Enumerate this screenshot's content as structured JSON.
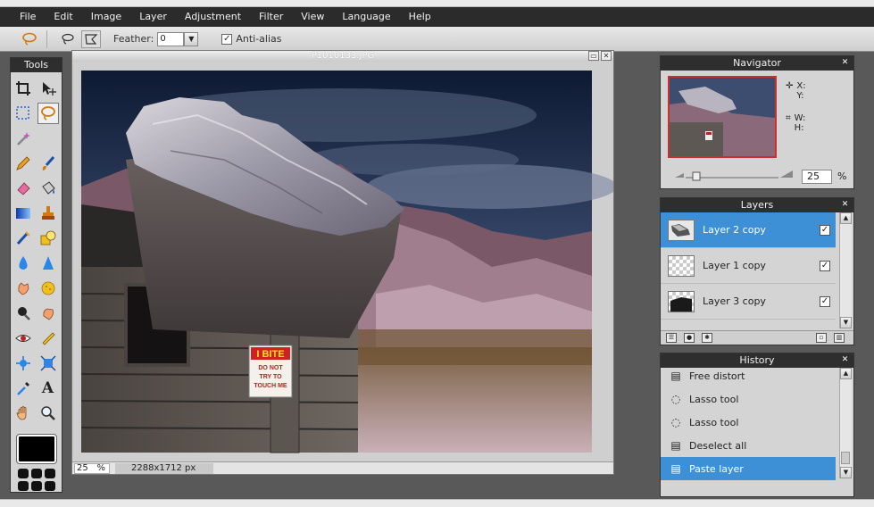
{
  "menu": [
    "File",
    "Edit",
    "Image",
    "Layer",
    "Adjustment",
    "Filter",
    "View",
    "Language",
    "Help"
  ],
  "options": {
    "feather_label": "Feather:",
    "feather_value": "0",
    "antialias_label": "Anti-alias",
    "antialias_checked": true
  },
  "tools_panel": {
    "title": "Tools",
    "tools": [
      "crop-icon",
      "move-icon",
      "marquee-icon",
      "lasso-icon",
      "magic-wand-icon",
      "pencil-icon",
      "brush-icon",
      "eraser-icon",
      "bucket-icon",
      "gradient-icon",
      "stamp-icon",
      "color-replace-icon",
      "shape-icon",
      "blur-icon",
      "sharpen-icon",
      "smudge-icon",
      "sponge-icon",
      "dodge-icon",
      "burn-icon",
      "redeye-icon",
      "spot-heal-icon",
      "bloat-icon",
      "pinch-icon",
      "color-picker-icon",
      "text-icon",
      "hand-icon",
      "zoom-icon"
    ],
    "primary_color": "#000000"
  },
  "document": {
    "title": "P1010133.JPG",
    "zoom": "25",
    "zoom_unit": "%",
    "size": "2288x1712 px",
    "sign_line1": "I BITE",
    "sign_line2": "DO NOT",
    "sign_line3": "TRY TO",
    "sign_line4": "TOUCH ME"
  },
  "navigator": {
    "title": "Navigator",
    "x_label": "X:",
    "y_label": "Y:",
    "w_label": "W:",
    "h_label": "H:",
    "zoom_value": "25",
    "zoom_unit": "%"
  },
  "layers": {
    "title": "Layers",
    "items": [
      {
        "name": "Layer 2 copy",
        "selected": true,
        "visible": true
      },
      {
        "name": "Layer 1 copy",
        "selected": false,
        "visible": true
      },
      {
        "name": "Layer 3 copy",
        "selected": false,
        "visible": true
      }
    ]
  },
  "history": {
    "title": "History",
    "items": [
      {
        "name": "Free distort",
        "selected": false
      },
      {
        "name": "Lasso tool",
        "selected": false
      },
      {
        "name": "Lasso tool",
        "selected": false
      },
      {
        "name": "Deselect all",
        "selected": false
      },
      {
        "name": "Paste layer",
        "selected": true
      }
    ]
  },
  "colors": {
    "accent": "#3d8fd6",
    "panel_title": "#2e2e2e"
  }
}
